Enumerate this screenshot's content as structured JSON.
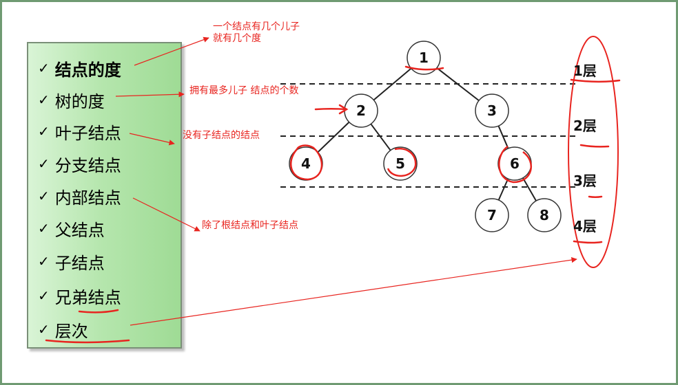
{
  "terms": [
    {
      "label": "结点的度",
      "bold": true
    },
    {
      "label": "树的度",
      "bold": false
    },
    {
      "label": "叶子结点",
      "bold": false
    },
    {
      "label": "分支结点",
      "bold": false
    },
    {
      "label": "内部结点",
      "bold": false
    },
    {
      "label": "父结点",
      "bold": false
    },
    {
      "label": "子结点",
      "bold": false
    },
    {
      "label": "兄弟结点",
      "bold": false
    },
    {
      "label": "层次",
      "bold": false
    }
  ],
  "check_mark": "✓",
  "annotations": {
    "node_degree_line1": "一个结点有几个儿子",
    "node_degree_line2": "就有几个度",
    "tree_degree": "拥有最多儿子  结点的个数",
    "leaf_node": "没有子结点的结点",
    "internal_node": "除了根结点和叶子结点"
  },
  "tree": {
    "nodes": [
      {
        "id": "1",
        "label": "1"
      },
      {
        "id": "2",
        "label": "2"
      },
      {
        "id": "3",
        "label": "3"
      },
      {
        "id": "4",
        "label": "4"
      },
      {
        "id": "5",
        "label": "5"
      },
      {
        "id": "6",
        "label": "6"
      },
      {
        "id": "7",
        "label": "7"
      },
      {
        "id": "8",
        "label": "8"
      }
    ],
    "edges": [
      [
        "1",
        "2"
      ],
      [
        "1",
        "3"
      ],
      [
        "2",
        "4"
      ],
      [
        "2",
        "5"
      ],
      [
        "3",
        "6"
      ],
      [
        "6",
        "7"
      ],
      [
        "6",
        "8"
      ]
    ]
  },
  "levels": [
    "1层",
    "2层",
    "3层",
    "4层"
  ],
  "colors": {
    "annotation": "#e8241f",
    "panel": "#b5e6ad",
    "frame": "#6f9a72"
  }
}
